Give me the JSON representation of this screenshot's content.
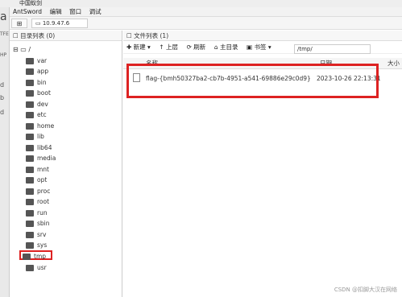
{
  "window": {
    "title": "中国蚁剑"
  },
  "menu": [
    "AntSword",
    "编辑",
    "窗口",
    "调试"
  ],
  "tabs": {
    "grid_label": "⊞",
    "host_label": "10.9.47.6"
  },
  "left_panel": {
    "header": "目录列表 (0)",
    "root": "/",
    "items": [
      "var",
      "app",
      "bin",
      "boot",
      "dev",
      "etc",
      "home",
      "lib",
      "lib64",
      "media",
      "mnt",
      "opt",
      "proc",
      "root",
      "run",
      "sbin",
      "srv",
      "sys",
      "tmp",
      "usr"
    ],
    "selected": "tmp"
  },
  "right_panel": {
    "header": "文件列表 (1)",
    "toolbar": {
      "new": "新建",
      "up": "上层",
      "refresh": "刷新",
      "home": "主目录",
      "bookmark": "书签"
    },
    "path": "/tmp/",
    "columns": {
      "name": "名称",
      "date": "日期",
      "size": "大小"
    },
    "files": [
      {
        "name": "flag-{bmh50327ba2-cb7b-4951-a541-69886e29c0d9}",
        "date": "2023-10-26 22:13:31"
      }
    ]
  },
  "leftedge_fragments": [
    "a",
    "TFE",
    "HP",
    "d",
    "b",
    "d"
  ],
  "watermark": "CSDN @扣脚大汉在网络"
}
